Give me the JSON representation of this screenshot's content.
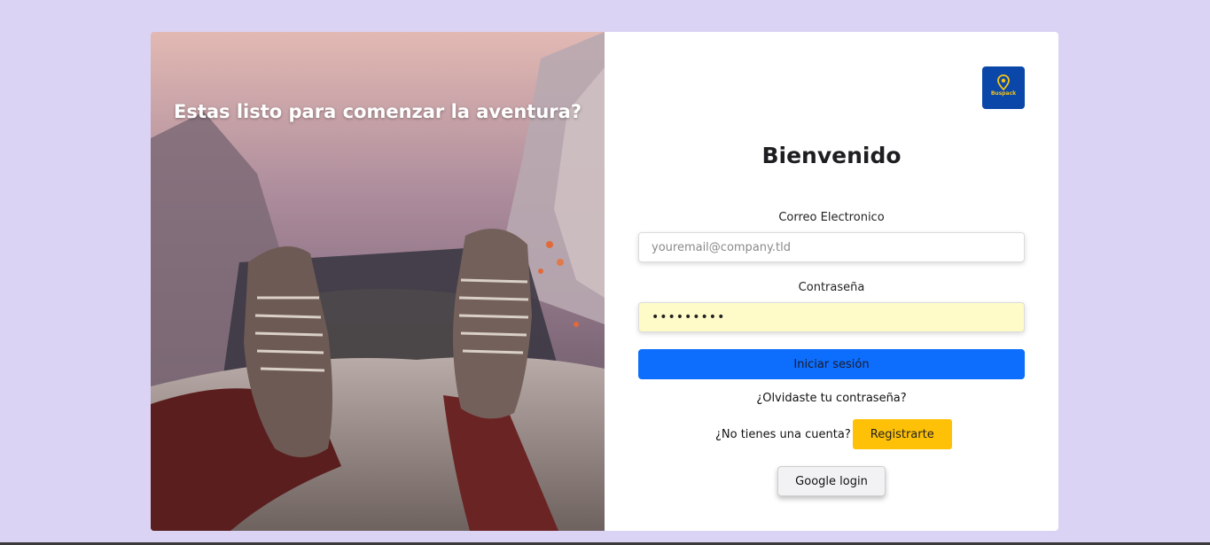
{
  "hero": {
    "title": "Estas listo para comenzar la aventura?",
    "image": "mountain-sneakers-photo"
  },
  "logo": {
    "text": "Buspack",
    "icon": "location-pin-icon",
    "bg": "#0b47a8",
    "accent": "#f5c518"
  },
  "login": {
    "heading": "Bienvenido",
    "email_label": "Correo Electronico",
    "email_placeholder": "youremail@company.tld",
    "email_value": "",
    "password_label": "Contraseña",
    "password_value": "•••••••••",
    "submit_label": "Iniciar sesión",
    "forgot_label": "¿Olvidaste tu contraseña?",
    "no_account_label": "¿No tienes una cuenta?",
    "register_label": "Registrarte",
    "google_label": "Google login"
  },
  "colors": {
    "background": "#dbd3f4",
    "primary": "#0d6efd",
    "register": "#ffc107",
    "autofill": "#fffbc8"
  }
}
